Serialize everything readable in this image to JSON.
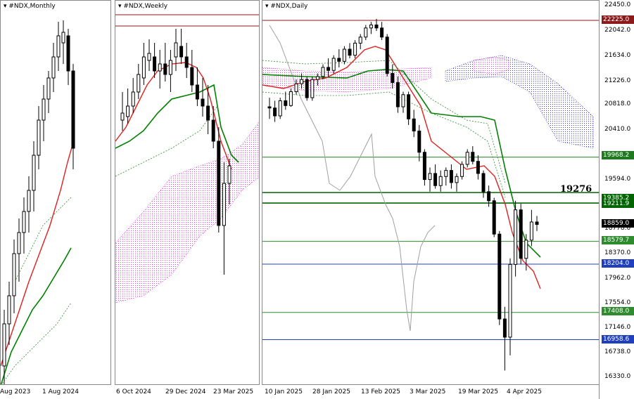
{
  "panels": [
    {
      "title": "▾ #NDX,Monthly",
      "xlabels": [
        "Aug 2023",
        "1 Aug 2024"
      ]
    },
    {
      "title": "▾ #NDX,Weekly",
      "xlabels": [
        "6 Oct 2024",
        "29 Dec 2024",
        "23 Mar 2025"
      ]
    },
    {
      "title": "▾ #NDX,Daily",
      "xlabels": [
        "10 Jan 2025",
        "28 Jan 2025",
        "13 Feb 2025",
        "3 Mar 2025",
        "19 Mar 2025",
        "4 Apr 2025"
      ]
    }
  ],
  "yaxis": {
    "ticks": [
      "22450.0",
      "22042.0",
      "21634.0",
      "21226.0",
      "20818.0",
      "20410.0",
      "19594.0",
      "18778.0",
      "18370.0",
      "17962.0",
      "17554.0",
      "17146.0",
      "16738.0",
      "16330.0"
    ]
  },
  "levels": [
    {
      "label": "22225.0",
      "color": "#8b1a1a"
    },
    {
      "label": "19968.2",
      "color": "#1e7a1e"
    },
    {
      "label": "19385.2",
      "color": "#006400"
    },
    {
      "label": "19211.9",
      "color": "#006400"
    },
    {
      "label": "18859.0",
      "color": "#000000"
    },
    {
      "label": "18579.7",
      "color": "#2e8b2e"
    },
    {
      "label": "18204.0",
      "color": "#1f3fbf"
    },
    {
      "label": "17408.0",
      "color": "#2e8b2e"
    },
    {
      "label": "16958.6",
      "color": "#1f3fbf"
    }
  ],
  "annotation": "19276",
  "chart_data": [
    {
      "type": "candlestick",
      "title": "#NDX,Monthly",
      "x": [
        "Aug 2023",
        "1 Aug 2024"
      ],
      "series": [
        {
          "values": []
        },
        {
          "name": "Tenkan-sen",
          "color": "#e02020"
        },
        {
          "name": "Kijun-sen",
          "color": "#008000"
        }
      ]
    },
    {
      "type": "candlestick",
      "title": "#NDX,Weekly",
      "x": [
        "6 Oct 2024",
        "29 Dec 2024",
        "23 Mar 2025"
      ],
      "series": [
        {
          "values": []
        },
        {
          "name": "Tenkan-sen",
          "color": "#e02020"
        },
        {
          "name": "Kijun-sen",
          "color": "#008000"
        },
        {
          "name": "Senkou Span",
          "color": "#e040e0"
        }
      ]
    },
    {
      "type": "candlestick",
      "title": "#NDX,Daily",
      "x": [
        "10 Jan 2025",
        "28 Jan 2025",
        "13 Feb 2025",
        "3 Mar 2025",
        "19 Mar 2025",
        "4 Apr 2025"
      ],
      "ylim": [
        16200,
        22550
      ],
      "series": [
        {
          "name": "Candles",
          "values": [
            [
              20800,
              20950,
              20600,
              20780
            ],
            [
              20780,
              20900,
              20550,
              20650
            ],
            [
              20650,
              20950,
              20600,
              20900
            ],
            [
              20900,
              21050,
              20750,
              20820
            ],
            [
              20820,
              21100,
              20800,
              21050
            ],
            [
              21050,
              21250,
              21000,
              21180
            ],
            [
              21180,
              21350,
              21100,
              21250
            ],
            [
              21250,
              21300,
              20900,
              20950
            ],
            [
              20950,
              21300,
              20900,
              21250
            ],
            [
              21250,
              21350,
              21150,
              21300
            ],
            [
              21300,
              21500,
              21250,
              21450
            ],
            [
              21450,
              21600,
              21300,
              21400
            ],
            [
              21400,
              21650,
              21350,
              21600
            ],
            [
              21600,
              21750,
              21450,
              21550
            ],
            [
              21550,
              21800,
              21500,
              21750
            ],
            [
              21750,
              21850,
              21600,
              21650
            ],
            [
              21650,
              21900,
              21600,
              21850
            ],
            [
              21850,
              22000,
              21750,
              21950
            ],
            [
              21950,
              22150,
              21900,
              22100
            ],
            [
              22100,
              22200,
              22000,
              22150
            ],
            [
              22150,
              22250,
              22050,
              22100
            ],
            [
              22100,
              22200,
              21900,
              21950
            ],
            [
              21950,
              22000,
              21300,
              21350
            ],
            [
              21350,
              21500,
              21100,
              21200
            ],
            [
              21200,
              21300,
              20700,
              20800
            ],
            [
              20800,
              21050,
              20700,
              21000
            ],
            [
              21000,
              21050,
              20500,
              20600
            ],
            [
              20600,
              20750,
              20300,
              20400
            ],
            [
              20400,
              20500,
              19900,
              20050
            ],
            [
              20050,
              20100,
              19500,
              19600
            ],
            [
              19600,
              19800,
              19400,
              19700
            ],
            [
              19700,
              19850,
              19450,
              19500
            ],
            [
              19500,
              19750,
              19400,
              19650
            ],
            [
              19650,
              19800,
              19500,
              19750
            ],
            [
              19750,
              19850,
              19450,
              19550
            ],
            [
              19550,
              19700,
              19400,
              19650
            ],
            [
              19650,
              19900,
              19600,
              19850
            ],
            [
              19850,
              20100,
              19800,
              20050
            ],
            [
              20050,
              20150,
              19850,
              19900
            ],
            [
              19900,
              20000,
              19600,
              19700
            ],
            [
              19700,
              19750,
              19300,
              19400
            ],
            [
              19400,
              19500,
              19150,
              19250
            ],
            [
              19250,
              19300,
              18650,
              18700
            ],
            [
              18700,
              18750,
              17200,
              17300
            ],
            [
              17300,
              17500,
              16450,
              17000
            ],
            [
              17000,
              18300,
              16700,
              18200
            ],
            [
              18200,
              19250,
              18000,
              19100
            ],
            [
              19100,
              19200,
              18200,
              18300
            ],
            [
              18300,
              18700,
              18100,
              18600
            ],
            [
              18600,
              19100,
              18500,
              18900
            ],
            [
              18900,
              19000,
              18750,
              18859
            ]
          ]
        },
        {
          "name": "Tenkan-sen",
          "color": "#e02020"
        },
        {
          "name": "Kijun-sen",
          "color": "#008000"
        },
        {
          "name": "Chikou Span",
          "color": "#a0a0a0"
        },
        {
          "name": "Senkou Span A",
          "color": "#e040e0"
        },
        {
          "name": "Senkou Span B",
          "color": "#3a3acc"
        }
      ]
    }
  ]
}
